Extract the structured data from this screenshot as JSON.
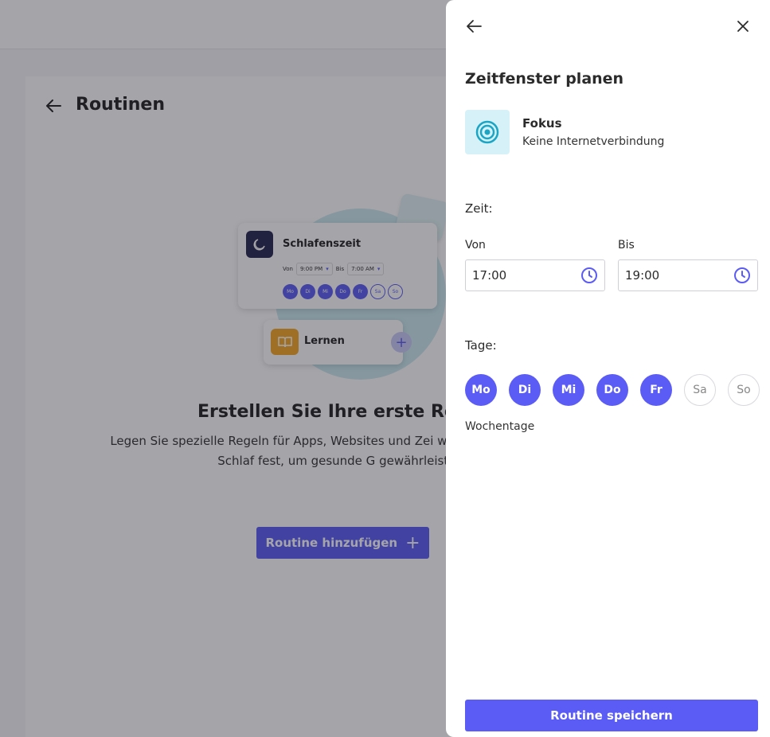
{
  "background": {
    "title": "Routinen",
    "illustration": {
      "card1_name": "Schlafenszeit",
      "from_label": "Von",
      "from_value": "9:00 PM",
      "to_label": "Bis",
      "to_value": "7:00 AM",
      "days": [
        "Mo",
        "Di",
        "Mi",
        "Do",
        "Fr",
        "Sa",
        "So"
      ],
      "card2_name": "Lernen"
    },
    "headline": "Erstellen Sie Ihre erste Rou",
    "description": "Legen Sie spezielle Regeln für Apps, Websites und Zei wie Hausaufgaben und Schlaf fest, um gesunde G gewährleisten.",
    "cta_label": "Routine hinzufügen"
  },
  "drawer": {
    "title": "Zeitfenster planen",
    "mode": {
      "name": "Fokus",
      "description": "Keine Internetverbindung",
      "icon": "target-icon"
    },
    "time_label": "Zeit:",
    "from_label": "Von",
    "from_value": "17:00",
    "to_label": "Bis",
    "to_value": "19:00",
    "days_label": "Tage:",
    "days": [
      {
        "label": "Mo",
        "selected": true
      },
      {
        "label": "Di",
        "selected": true
      },
      {
        "label": "Mi",
        "selected": true
      },
      {
        "label": "Do",
        "selected": true
      },
      {
        "label": "Fr",
        "selected": true
      },
      {
        "label": "Sa",
        "selected": false
      },
      {
        "label": "So",
        "selected": false
      }
    ],
    "days_summary": "Wochentage",
    "save_label": "Routine speichern"
  },
  "colors": {
    "accent": "#5b5bf5",
    "mode_tile": "#d6f1f7",
    "mode_icon": "#1aa6c4"
  }
}
